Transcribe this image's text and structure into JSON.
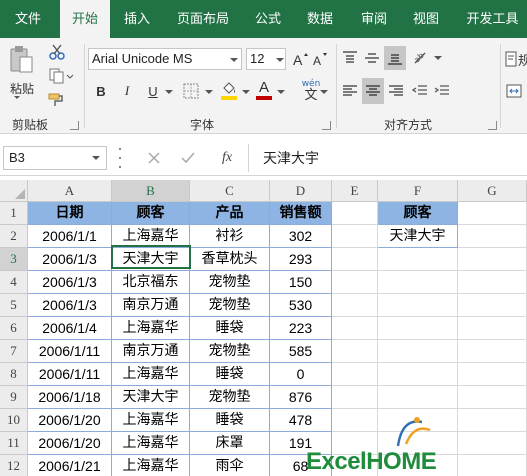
{
  "tabs": [
    "文件",
    "开始",
    "插入",
    "页面布局",
    "公式",
    "数据",
    "审阅",
    "视图",
    "开发工具"
  ],
  "ribbon": {
    "paste_label": "粘贴",
    "clipboard_label": "剪贴板",
    "font_label": "字体",
    "align_label": "对齐方式",
    "font_name": "Arial Unicode MS",
    "font_size": "12",
    "bold": "B",
    "italic": "I",
    "underline": "U",
    "font_color_glyph": "A",
    "wen_glyph": "wén",
    "wen_sub": "文",
    "wrap_partial": "规",
    "fill_color": "#ffd500",
    "font_color": "#c00000"
  },
  "formula_bar": {
    "name_box": "B3",
    "fx": "fx",
    "value": "天津大宇"
  },
  "columns": [
    "A",
    "B",
    "C",
    "D",
    "E",
    "F",
    "G"
  ],
  "rows": [
    "1",
    "2",
    "3",
    "4",
    "5",
    "6",
    "7",
    "8",
    "9",
    "10",
    "11",
    "12"
  ],
  "table": {
    "headers": [
      "日期",
      "顾客",
      "产品",
      "销售额"
    ],
    "rows": [
      [
        "2006/1/1",
        "上海嘉华",
        "衬衫",
        "302"
      ],
      [
        "2006/1/3",
        "天津大宇",
        "香草枕头",
        "293"
      ],
      [
        "2006/1/3",
        "北京福东",
        "宠物垫",
        "150"
      ],
      [
        "2006/1/3",
        "南京万通",
        "宠物垫",
        "530"
      ],
      [
        "2006/1/4",
        "上海嘉华",
        "睡袋",
        "223"
      ],
      [
        "2006/1/11",
        "南京万通",
        "宠物垫",
        "585"
      ],
      [
        "2006/1/11",
        "上海嘉华",
        "睡袋",
        "0"
      ],
      [
        "2006/1/18",
        "天津大宇",
        "宠物垫",
        "876"
      ],
      [
        "2006/1/20",
        "上海嘉华",
        "睡袋",
        "478"
      ],
      [
        "2006/1/20",
        "上海嘉华",
        "床罩",
        "191"
      ],
      [
        "2006/1/21",
        "上海嘉华",
        "雨伞",
        "68"
      ]
    ]
  },
  "criteria": {
    "header": "顾客",
    "value": "天津大宇"
  },
  "watermark": "ExcelHOME"
}
